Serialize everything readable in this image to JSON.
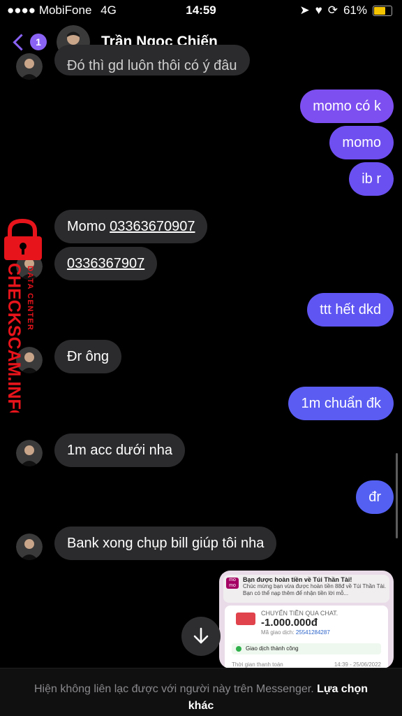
{
  "status": {
    "carrier": "MobiFone",
    "network": "4G",
    "time": "14:59",
    "battery": "61%",
    "battery_level": 0.61
  },
  "header": {
    "back_count": "1",
    "contact_name": "Trần Ngọc Chiến"
  },
  "messages": {
    "partial_top": "Đó thì gd luôn thôi có ý đâu",
    "m1": "momo có k",
    "m2": "momo",
    "m3": "ib r",
    "m4_prefix": "Momo ",
    "m4_link": "03363670907",
    "m5_link": "0336367907",
    "m6": "ttt hết dkd",
    "m7": "Đr ông",
    "m8": "1m chuẩn đk",
    "m9": "1m acc dưới nha",
    "m10": "đr",
    "m11": "Bank xong chụp bill giúp tôi nha"
  },
  "screenshot": {
    "logo": "mo mo",
    "notif_title": "Bạn được hoàn tiền về Túi Thần Tài!",
    "notif_body": "Chúc mừng bạn vừa được hoàn tiền 88đ về Túi Thần Tài. Bạn có thể nạp thêm để nhận tiền lời mỗ...",
    "transfer_label": "CHUYỂN TIỀN QUA CHAT.",
    "amount": "-1.000.000đ",
    "txn_label": "Mã giao dịch:",
    "txn_id": "25541284287",
    "success": "Giao dịch thành công",
    "time_label": "Thời gian thanh toán",
    "time_value": "14:39 - 25/06/2022"
  },
  "watermark": {
    "brand": "CHECKSCAM.INFO",
    "sub": "DATA CENTER"
  },
  "footer": {
    "notice": "Hiện không liên lạc được với người này trên Messenger.",
    "action": "Lựa chọn khác"
  },
  "colors": {
    "accent": "#8a63f5",
    "out_top": "#7f4ff0",
    "out_bottom": "#5a5cf2",
    "in_bubble": "#2b2b2d"
  }
}
